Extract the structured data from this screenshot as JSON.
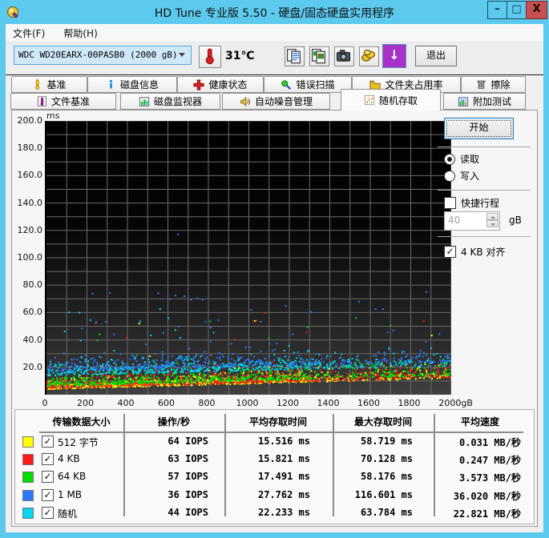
{
  "window": {
    "title": "HD Tune 专业版 5.50 - 硬盘/固态硬盘实用程序",
    "controls": {
      "minimize": "–",
      "maximize": "□",
      "close": "X"
    }
  },
  "menu": {
    "items": [
      "文件(F)",
      "帮助(H)"
    ]
  },
  "toolbar": {
    "drive_select": "WDC WD20EARX-00PASB0 (2000 gB)",
    "temperature": "31℃",
    "update_glyph": "↓",
    "exit_label": "退出"
  },
  "tabs": {
    "row1": [
      "基准",
      "磁盘信息",
      "健康状态",
      "错误扫描",
      "文件夹占用率",
      "擦除"
    ],
    "row2": [
      "文件基准",
      "磁盘监视器",
      "自动噪音管理",
      "随机存取",
      "附加测试"
    ],
    "active": "随机存取"
  },
  "controls": {
    "start_label": "开始",
    "read_label": "读取",
    "write_label": "写入",
    "read_selected": true,
    "short_stroke_label": "快捷行程",
    "short_stroke_checked": false,
    "short_stroke_value": "40",
    "short_stroke_unit": "gB",
    "align_label": "4 KB 对齐",
    "align_checked": true,
    "check_glyph": "✓"
  },
  "chart_data": {
    "type": "scatter",
    "title": "随机存取 access time vs position",
    "ylabel": "ms",
    "xlabel_unit": "gB",
    "xlim": [
      0,
      2000
    ],
    "ylim": [
      0,
      200
    ],
    "x_ticks": [
      "0",
      "200",
      "400",
      "600",
      "800",
      "1000",
      "1200",
      "1400",
      "1600",
      "1800",
      "2000gB"
    ],
    "x_tick_values": [
      0,
      200,
      400,
      600,
      800,
      1000,
      1200,
      1400,
      1600,
      1800,
      2000
    ],
    "y_ticks": [
      "200.0",
      "180.0",
      "160.0",
      "140.0",
      "120.0",
      "100.0",
      "80.0",
      "60.0",
      "40.0",
      "20.0"
    ],
    "y_tick_values": [
      200,
      180,
      160,
      140,
      120,
      100,
      80,
      60,
      40,
      20
    ],
    "grid_step_x_gb": 100,
    "grid_step_y_ms": 10,
    "series": [
      {
        "name": "512 字节",
        "color": "#ffff00",
        "iops": 64,
        "avg_ms": 15.516,
        "max_ms": 58.719,
        "speed_mb_s": 0.031,
        "gen": {
          "seed": 11,
          "count": 700,
          "floor0": 4.0,
          "floor1": 12.0,
          "spread": 5.5,
          "cap": 23,
          "outlier_p": 0.012,
          "outlier_max": 58
        }
      },
      {
        "name": "4 KB",
        "color": "#ff1a1a",
        "iops": 63,
        "avg_ms": 15.821,
        "max_ms": 70.128,
        "speed_mb_s": 0.247,
        "gen": {
          "seed": 22,
          "count": 700,
          "floor0": 4.5,
          "floor1": 12.5,
          "spread": 6.0,
          "cap": 24,
          "outlier_p": 0.012,
          "outlier_max": 70
        }
      },
      {
        "name": "64 KB",
        "color": "#00dd00",
        "iops": 57,
        "avg_ms": 17.491,
        "max_ms": 58.176,
        "speed_mb_s": 3.573,
        "gen": {
          "seed": 33,
          "count": 650,
          "floor0": 6.0,
          "floor1": 14.0,
          "spread": 6.0,
          "cap": 26,
          "outlier_p": 0.015,
          "outlier_max": 58
        }
      },
      {
        "name": "1 MB",
        "color": "#2979ff",
        "iops": 36,
        "avg_ms": 27.762,
        "max_ms": 116.601,
        "speed_mb_s": 36.02,
        "gen": {
          "seed": 44,
          "count": 520,
          "floor0": 17.0,
          "floor1": 24.0,
          "spread": 7.0,
          "cap": 42,
          "outlier_p": 0.05,
          "outlier_max": 75,
          "extreme_x": 650,
          "extreme_y": 117
        }
      },
      {
        "name": "随机",
        "color": "#00d5f2",
        "iops": 44,
        "avg_ms": 22.233,
        "max_ms": 63.784,
        "speed_mb_s": 22.821,
        "gen": {
          "seed": 55,
          "count": 520,
          "floor0": 14.0,
          "floor1": 21.0,
          "spread": 6.0,
          "cap": 36,
          "outlier_p": 0.04,
          "outlier_max": 64
        }
      }
    ]
  },
  "table": {
    "headers": [
      "传输数据大小",
      "操作/秒",
      "平均存取时间",
      "最大存取时间",
      "平均速度"
    ],
    "rows": [
      {
        "color": "#ffff00",
        "label": "512 字节",
        "iops": "64 IOPS",
        "avg": "15.516 ms",
        "max": "58.719 ms",
        "speed": "0.031 MB/秒",
        "checked": true
      },
      {
        "color": "#ff1a1a",
        "label": "4 KB",
        "iops": "63 IOPS",
        "avg": "15.821 ms",
        "max": "70.128 ms",
        "speed": "0.247 MB/秒",
        "checked": true
      },
      {
        "color": "#00dd00",
        "label": "64 KB",
        "iops": "57 IOPS",
        "avg": "17.491 ms",
        "max": "58.176 ms",
        "speed": "3.573 MB/秒",
        "checked": true
      },
      {
        "color": "#2979ff",
        "label": "1 MB",
        "iops": "36 IOPS",
        "avg": "27.762 ms",
        "max": "116.601 ms",
        "speed": "36.020 MB/秒",
        "checked": true
      },
      {
        "color": "#00d5f2",
        "label": "随机",
        "iops": "44 IOPS",
        "avg": "22.233 ms",
        "max": "63.784 ms",
        "speed": "22.821 MB/秒",
        "checked": true
      }
    ]
  }
}
